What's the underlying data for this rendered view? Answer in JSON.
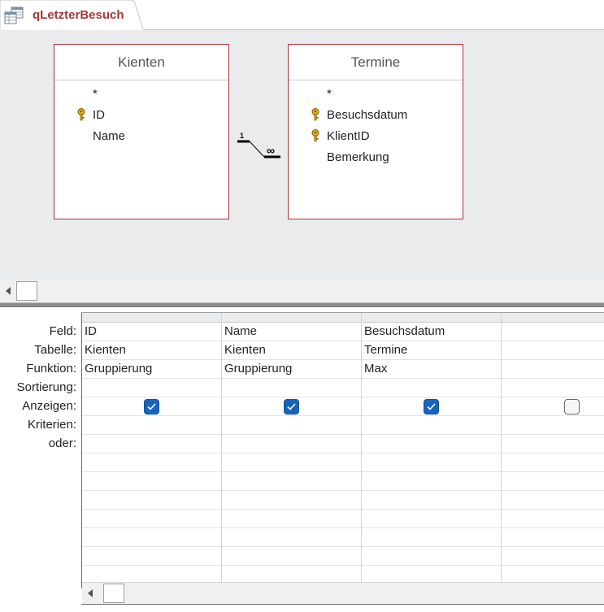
{
  "tab": {
    "title": "qLetzterBesuch",
    "icon": "query-datasheet-icon",
    "accent_color": "#a4373a"
  },
  "design": {
    "tables": [
      {
        "name": "Kienten",
        "fields": [
          {
            "label": "*",
            "key": false
          },
          {
            "label": "ID",
            "key": true
          },
          {
            "label": "Name",
            "key": false
          }
        ]
      },
      {
        "name": "Termine",
        "fields": [
          {
            "label": "*",
            "key": false
          },
          {
            "label": "Besuchsdatum",
            "key": true
          },
          {
            "label": "KlientID",
            "key": true
          },
          {
            "label": "Bemerkung",
            "key": false
          }
        ]
      }
    ],
    "relationship": {
      "one_side": "1",
      "many_side": "∞"
    }
  },
  "grid": {
    "row_labels": [
      "Feld:",
      "Tabelle:",
      "Funktion:",
      "Sortierung:",
      "Anzeigen:",
      "Kriterien:",
      "oder:"
    ],
    "columns": [
      {
        "feld": "ID",
        "tabelle": "Kienten",
        "funktion": "Gruppierung",
        "sortierung": "",
        "anzeigen": true,
        "kriterien": "",
        "oder": ""
      },
      {
        "feld": "Name",
        "tabelle": "Kienten",
        "funktion": "Gruppierung",
        "sortierung": "",
        "anzeigen": true,
        "kriterien": "",
        "oder": ""
      },
      {
        "feld": "Besuchsdatum",
        "tabelle": "Termine",
        "funktion": "Max",
        "sortierung": "",
        "anzeigen": true,
        "kriterien": "",
        "oder": ""
      },
      {
        "feld": "",
        "tabelle": "",
        "funktion": "",
        "sortierung": "",
        "anzeigen": false,
        "kriterien": "",
        "oder": ""
      }
    ],
    "checkbox_color": "#1565c0"
  }
}
